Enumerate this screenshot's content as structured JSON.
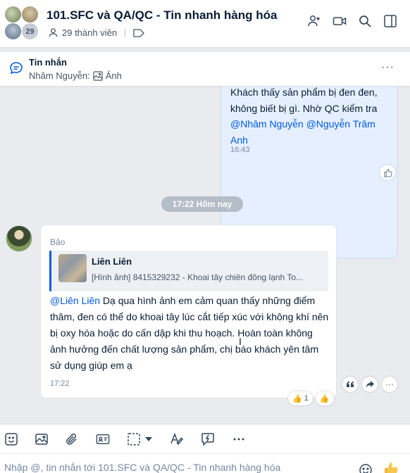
{
  "header": {
    "group_avatar_count": "29",
    "title": "101.SFC và QA/QC - Tin nhanh hàng hóa",
    "members": "29 thành viên",
    "icons": [
      "add-member-icon",
      "video-call-icon",
      "search-icon",
      "sidebar-toggle-icon"
    ]
  },
  "pinned": {
    "title": "Tin nhắn",
    "sender": "Nhâm Nguyễn:",
    "attachment": "Ảnh"
  },
  "messages": {
    "mine": {
      "text_lines": [
        "Khách thấy sản phẩm bị đen đen,",
        "không biết bị gì. Nhờ QC kiểm tra"
      ],
      "mention1": "@Nhâm Nguyễn",
      "mention2": "@Nguyễn Trâm",
      "mention2b": "Anh",
      "time": "16:43"
    },
    "time_separator": "17:22 Hôm nay",
    "theirs": {
      "sender": "Bảo",
      "quote_name": "Liên Liên",
      "quote_text": "[Hình ảnh] 8415329232 - Khoai tây chiên đông lạnh To...",
      "mention": "@Liên Liên",
      "body": " Dạ qua hình ảnh em cảm quan thấy những điểm thâm, đen có thể do khoai tây lúc cắt tiếp xúc với không khí nên bị oxy hóa hoặc do cấn dập khi thu hoạch. Hoàn toàn không ảnh hưởng đến chất lượng sản phẩm, chị báo khách yên tâm sử dụng giúp em ạ",
      "time": "17:22",
      "reaction_count": "1"
    }
  },
  "composer": {
    "placeholder": "Nhập @, tin nhắn tới 101.SFC và QA/QC - Tin nhanh hàng hóa"
  },
  "colors": {
    "accent": "#005ae0",
    "my_bubble": "#e5efff",
    "background": "#e9ebee"
  }
}
